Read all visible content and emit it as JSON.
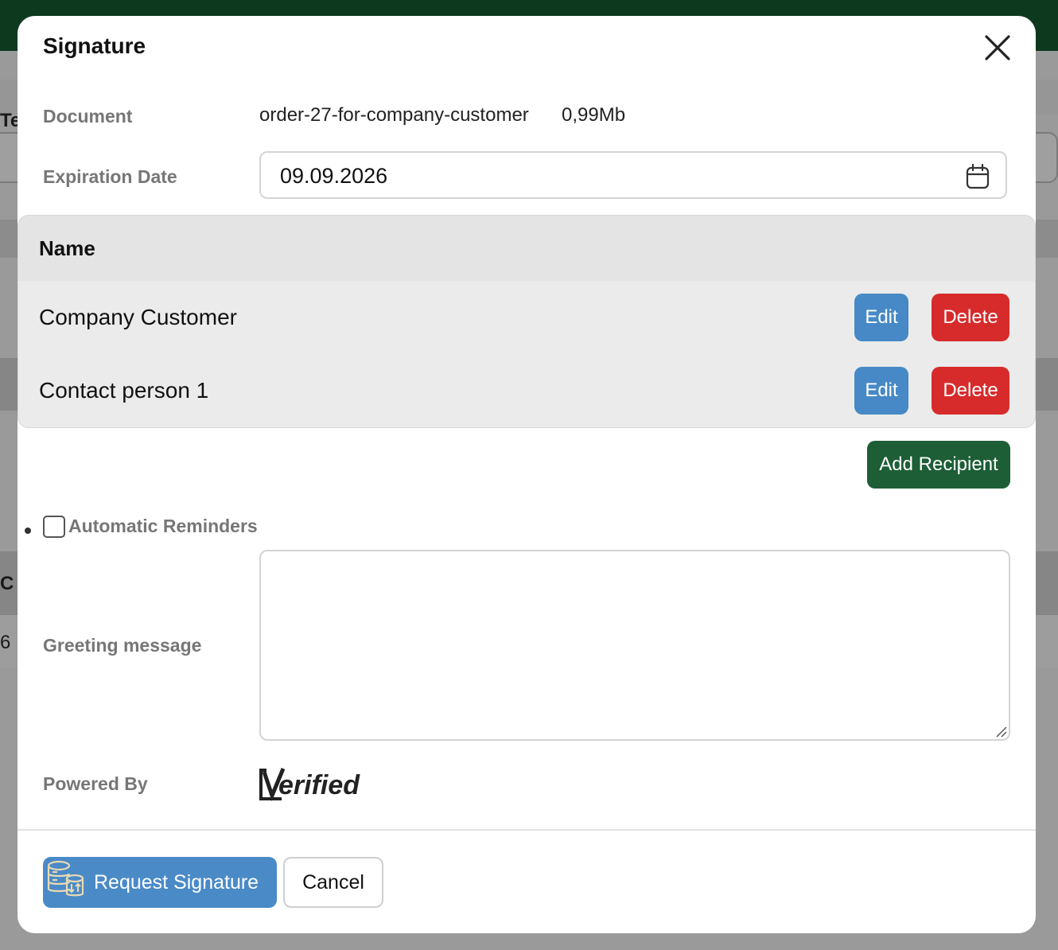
{
  "background": {
    "partial_texts": [
      "Te",
      "C",
      "6"
    ]
  },
  "modal": {
    "title": "Signature",
    "close_icon": "close-icon"
  },
  "document": {
    "label": "Document",
    "name": "order-27-for-company-customer",
    "size": "0,99Mb"
  },
  "expiration": {
    "label": "Expiration Date",
    "value": "09.09.2026",
    "icon": "calendar-icon"
  },
  "recipients": {
    "header": "Name",
    "rows": [
      {
        "name": "Company Customer",
        "edit_label": "Edit",
        "delete_label": "Delete"
      },
      {
        "name": "Contact person 1",
        "edit_label": "Edit",
        "delete_label": "Delete"
      }
    ],
    "add_label": "Add Recipient"
  },
  "reminders": {
    "label": "Automatic Reminders",
    "checked": false
  },
  "greeting": {
    "label": "Greeting message",
    "value": ""
  },
  "powered_by": {
    "label": "Powered By",
    "logo_text": "Verified"
  },
  "footer": {
    "request_label": "Request Signature",
    "cancel_label": "Cancel"
  },
  "colors": {
    "primary_blue": "#4a8ac7",
    "edit_blue": "#4689c6",
    "delete_red": "#d72b2b",
    "add_green": "#1d5e36",
    "topbar_green": "#0d3a1f"
  }
}
